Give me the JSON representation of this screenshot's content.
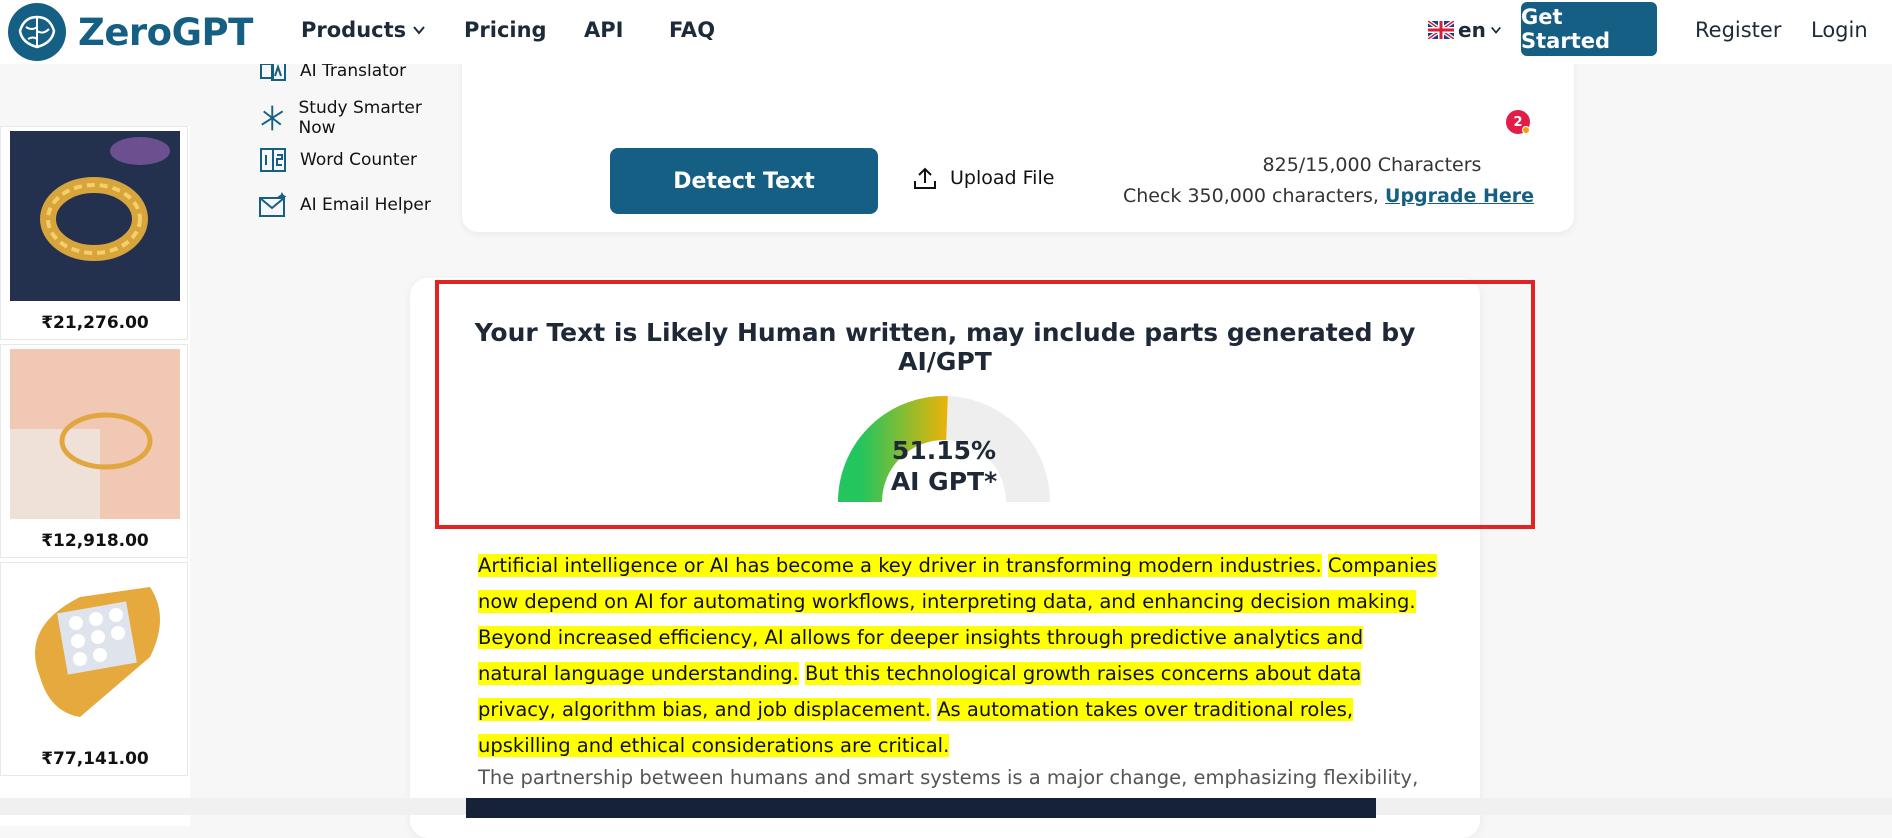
{
  "header": {
    "brand": "ZeroGPT",
    "nav": {
      "products": "Products",
      "pricing": "Pricing",
      "api": "API",
      "faq": "FAQ"
    },
    "lang": "en",
    "get_started": "Get Started",
    "register": "Register",
    "login": "Login"
  },
  "ads": [
    {
      "price": "₹21,276.00"
    },
    {
      "price": "₹12,918.00"
    },
    {
      "price": "₹77,141.00"
    }
  ],
  "tools": [
    {
      "label": "AI Translator",
      "icon": "translate-icon"
    },
    {
      "label": "Study Smarter Now",
      "icon": "sparkle-icon"
    },
    {
      "label": "Word Counter",
      "icon": "counter-icon"
    },
    {
      "label": "AI Email Helper",
      "icon": "email-icon"
    }
  ],
  "detector": {
    "notification_count": "2",
    "detect_label": "Detect Text",
    "upload_label": "Upload File",
    "char_count": "825/15,000 Characters",
    "upgrade_prefix": "Check 350,000 characters,",
    "upgrade_link": "Upgrade Here"
  },
  "result": {
    "title": "Your Text is Likely Human written, may include parts generated by AI/GPT",
    "percent": "51.15%",
    "percent_value": 51.15,
    "label": "AI GPT*",
    "gauge_colors": {
      "start": "#22c55e",
      "end": "#eab308",
      "track": "#eeeeee"
    },
    "highlight_color": "#ffff00",
    "sentences": [
      "Artificial intelligence or AI has become a key driver in transforming modern industries.",
      "Companies now depend on AI for automating workflows, interpreting data, and enhancing decision making.",
      "Beyond increased efficiency, AI allows for deeper insights through predictive analytics and natural language understanding.",
      "But this technological growth raises concerns about data privacy, algorithm bias, and job displacement.",
      "As automation takes over traditional roles, upskilling and ethical considerations are critical."
    ],
    "next_paragraph": "The partnership between humans and smart systems is a major change, emphasizing flexibility,"
  }
}
